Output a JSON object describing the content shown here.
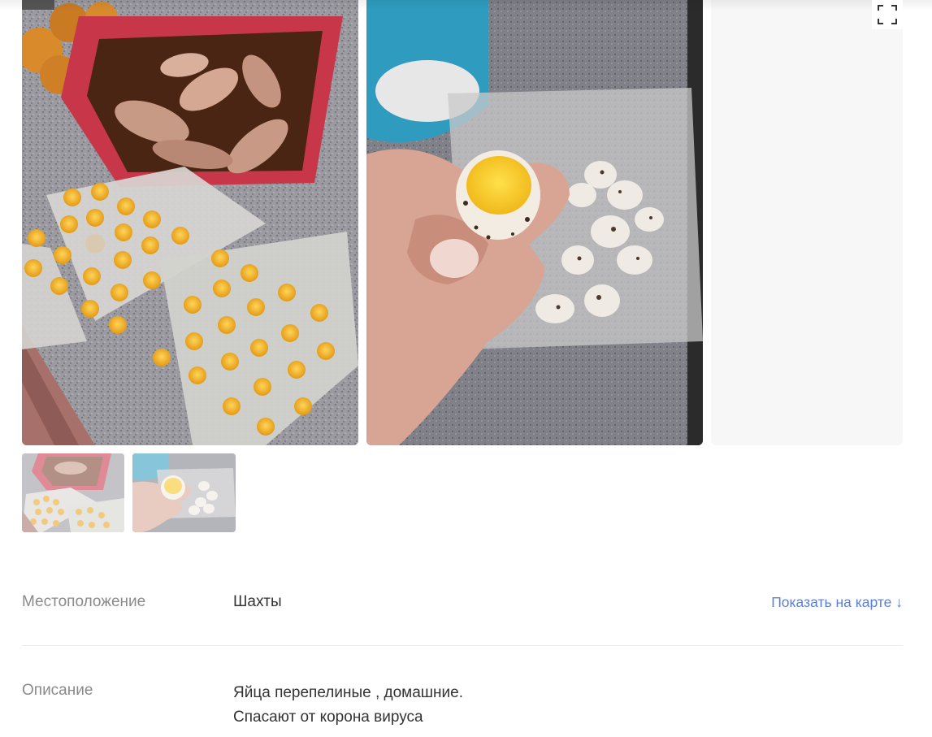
{
  "gallery": {
    "photos": [
      {
        "alt": "photo-1"
      },
      {
        "alt": "photo-2"
      }
    ],
    "expand_icon": "fullscreen-icon"
  },
  "thumbnails": [
    {
      "alt": "thumb-1"
    },
    {
      "alt": "thumb-2"
    }
  ],
  "location": {
    "label": "Местоположение",
    "value": "Шахты",
    "map_link": "Показать на карте ↓"
  },
  "description": {
    "label": "Описание",
    "lines": [
      "Яйца перепелиные , домашние.",
      "Спасают от корона вируса"
    ]
  },
  "colors": {
    "link": "#5b7fd9",
    "label": "#8a8a8a",
    "text": "#333333"
  }
}
